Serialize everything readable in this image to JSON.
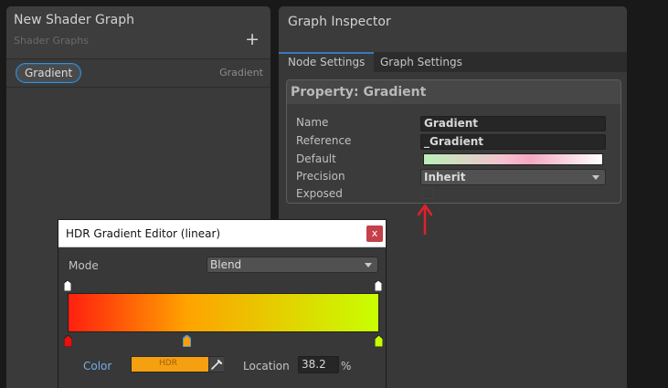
{
  "blackboard": {
    "title": "New Shader Graph",
    "subtitle": "Shader Graphs",
    "add_label": "+",
    "property": {
      "name": "Gradient",
      "type": "Gradient"
    }
  },
  "inspector": {
    "title": "Graph Inspector",
    "tabs": [
      {
        "label": "Node Settings",
        "active": true
      },
      {
        "label": "Graph Settings",
        "active": false
      }
    ],
    "property_header": "Property: Gradient",
    "fields": {
      "name_label": "Name",
      "name_value": "Gradient",
      "reference_label": "Reference",
      "reference_value": "_Gradient",
      "default_label": "Default",
      "precision_label": "Precision",
      "precision_value": "Inherit",
      "exposed_label": "Exposed",
      "exposed_checked": false
    }
  },
  "hdr_editor": {
    "title": "HDR Gradient Editor (linear)",
    "close_label": "x",
    "mode_label": "Mode",
    "mode_value": "Blend",
    "gradient_stops": [
      "#ff1f0f",
      "#ffa200",
      "#c8ff00"
    ],
    "color_label": "Color",
    "color_field_text": "HDR",
    "color_value": "#f4a010",
    "location_label": "Location",
    "location_value": "38.2",
    "location_unit": "%"
  },
  "colors": {
    "accent": "#3a79bb",
    "annotation_arrow": "#e0202a",
    "close_button": "#c5404a",
    "color_label": "#78aee8"
  }
}
